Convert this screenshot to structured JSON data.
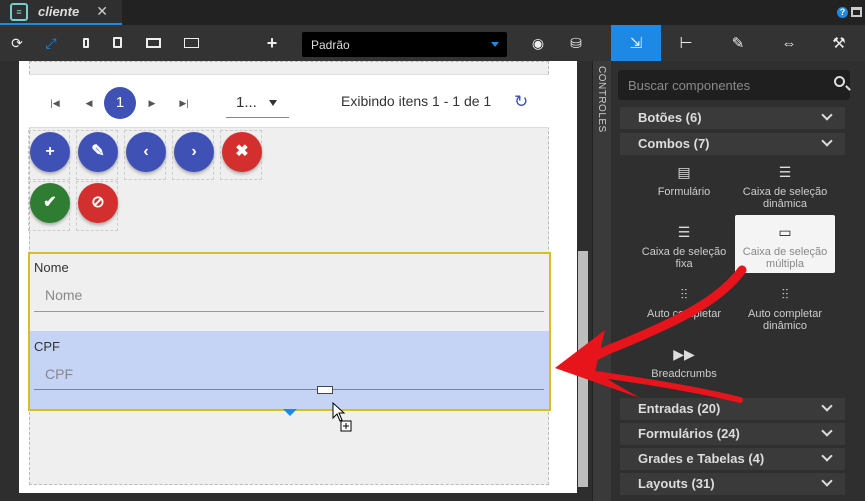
{
  "tab": {
    "label": "cliente",
    "close": "✕"
  },
  "toolbar": {
    "combo_value": "Padrão",
    "add": "+"
  },
  "pager": {
    "current_page": "1",
    "page_size": "1...",
    "info": "Exibindo itens 1 - 1 de 1"
  },
  "form": {
    "nome_label": "Nome",
    "nome_placeholder": "Nome",
    "cpf_label": "CPF",
    "cpf_placeholder": "CPF"
  },
  "controls_label": "CONTROLES",
  "search": {
    "placeholder": "Buscar componentes"
  },
  "categories": [
    {
      "label": "Botões (6)"
    },
    {
      "label": "Combos (7)"
    },
    {
      "label": "Entradas (20)"
    },
    {
      "label": "Formulários (24)"
    },
    {
      "label": "Grades e Tabelas (4)"
    },
    {
      "label": "Layouts (31)"
    }
  ],
  "components": [
    {
      "label": "Formulário"
    },
    {
      "label": "Caixa de seleção dinâmica"
    },
    {
      "label": "Caixa de seleção fixa"
    },
    {
      "label": "Caixa de seleção múltipla"
    },
    {
      "label": "Auto completar"
    },
    {
      "label": "Auto completar dinâmico"
    },
    {
      "label": "Breadcrumbs"
    }
  ],
  "colors": {
    "accent": "#1e88e5",
    "indigo": "#3f51b5",
    "danger": "#d32f2f",
    "success": "#2e7d32",
    "selection": "#c5d3f5",
    "arrow": "#e8141c"
  }
}
